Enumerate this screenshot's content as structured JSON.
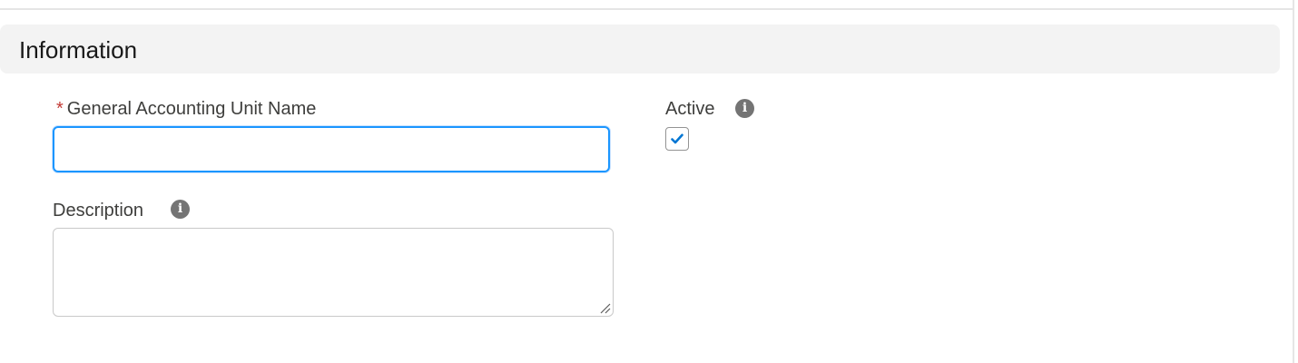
{
  "section": {
    "title": "Information"
  },
  "fields": {
    "name": {
      "required_marker": "*",
      "label": "General Accounting Unit Name",
      "value": "",
      "placeholder": ""
    },
    "description": {
      "label": "Description",
      "value": ""
    },
    "active": {
      "label": "Active",
      "checked": true
    }
  },
  "icons": {
    "info": "info-icon",
    "check": "checkmark-icon",
    "resize": "resize-grip-icon"
  },
  "colors": {
    "focus_border": "#1b96ff",
    "required": "#c23934",
    "check": "#0176d3",
    "header_bg": "#f3f3f3"
  }
}
